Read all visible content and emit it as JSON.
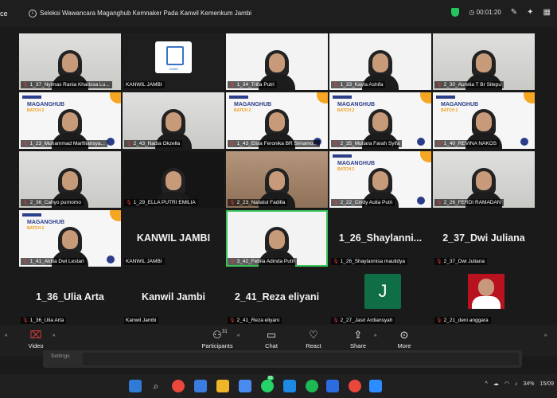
{
  "app": {
    "name": "ce"
  },
  "meeting": {
    "title": "Seleksi Wawancara Maganghub Kemnaker Pada Kanwil Kemenkum Jambi",
    "timer": "00:01:20"
  },
  "banner": {
    "line1": "MAGANGHUB",
    "line2": "BATCH 2"
  },
  "logo_caption": "JAMBI",
  "tiles": [
    {
      "name": "1_37_Nyimas Rania Kharissa Lu...",
      "style": "room",
      "muted": true
    },
    {
      "name": "KANWIL JAMBI",
      "style": "logo",
      "muted": false
    },
    {
      "name": "1_34_Trilia Putri",
      "style": "white",
      "muted": true
    },
    {
      "name": "1_33_Kayla Ashifa",
      "style": "white",
      "muted": true
    },
    {
      "name": "2_30_Aurelia T Br Sitepu",
      "style": "room",
      "muted": true
    },
    {
      "name": "1_23_Muhammad Marfiliansya...",
      "style": "banner",
      "muted": true
    },
    {
      "name": "2_43_Nadia Okzella",
      "style": "room",
      "muted": true
    },
    {
      "name": "1_43_Elisa Feronika BR Simamo...",
      "style": "banner",
      "muted": true
    },
    {
      "name": "2_35_Mutiara Farah Sylfa",
      "style": "banner",
      "muted": true
    },
    {
      "name": "1_40_REVINA NAKOS",
      "style": "banner",
      "muted": true
    },
    {
      "name": "2_36_Cahyo purnomo",
      "style": "room",
      "muted": true
    },
    {
      "name": "1_29_ELLA PUTRI EMILIA",
      "style": "dark",
      "muted": true
    },
    {
      "name": "2_23_Nailatul Fadilla",
      "style": "warm",
      "muted": true
    },
    {
      "name": "2_22_Cindy Aulia Putri",
      "style": "banner",
      "muted": true
    },
    {
      "name": "2_26_FERDI RAMADAN",
      "style": "room",
      "muted": true
    },
    {
      "name": "1_41_Aldila Dwi Lestari",
      "style": "banner",
      "muted": true
    },
    {
      "name": "KANWIL JAMBI",
      "style": "text",
      "big": "KANWIL JAMBI",
      "muted": false
    },
    {
      "name": "3_42_Febila Adinda Putri",
      "style": "white",
      "muted": true,
      "active": true
    },
    {
      "name": "1_26_Shaylannisa maulidya",
      "style": "text",
      "big": "1_26_Shaylanni...",
      "muted": true
    },
    {
      "name": "2_37_Dwi Juliana",
      "style": "text",
      "big": "2_37_Dwi Juliana",
      "muted": true
    },
    {
      "name": "1_36_Ulia Arta",
      "style": "text",
      "big": "1_36_Ulia Arta",
      "muted": true
    },
    {
      "name": "Kanwil Jambi",
      "style": "text",
      "big": "Kanwil Jambi",
      "muted": false
    },
    {
      "name": "2_41_Reza eliyani",
      "style": "text",
      "big": "2_41_Reza eliyani",
      "muted": true
    },
    {
      "name": "2_27_Jasri Ardiansyah",
      "style": "avatarJ",
      "avatar_letter": "J",
      "muted": true
    },
    {
      "name": "2_21_deni anggara",
      "style": "avatarPhoto",
      "muted": true
    }
  ],
  "toolbar": {
    "video": "Video",
    "participants": "Participants",
    "participants_count": "31",
    "chat": "Chat",
    "react": "React",
    "share": "Share",
    "more": "More"
  },
  "settings": {
    "label": "Settings"
  },
  "taskbar": {
    "battery": "34%",
    "date": "15/09",
    "badge": "99"
  }
}
